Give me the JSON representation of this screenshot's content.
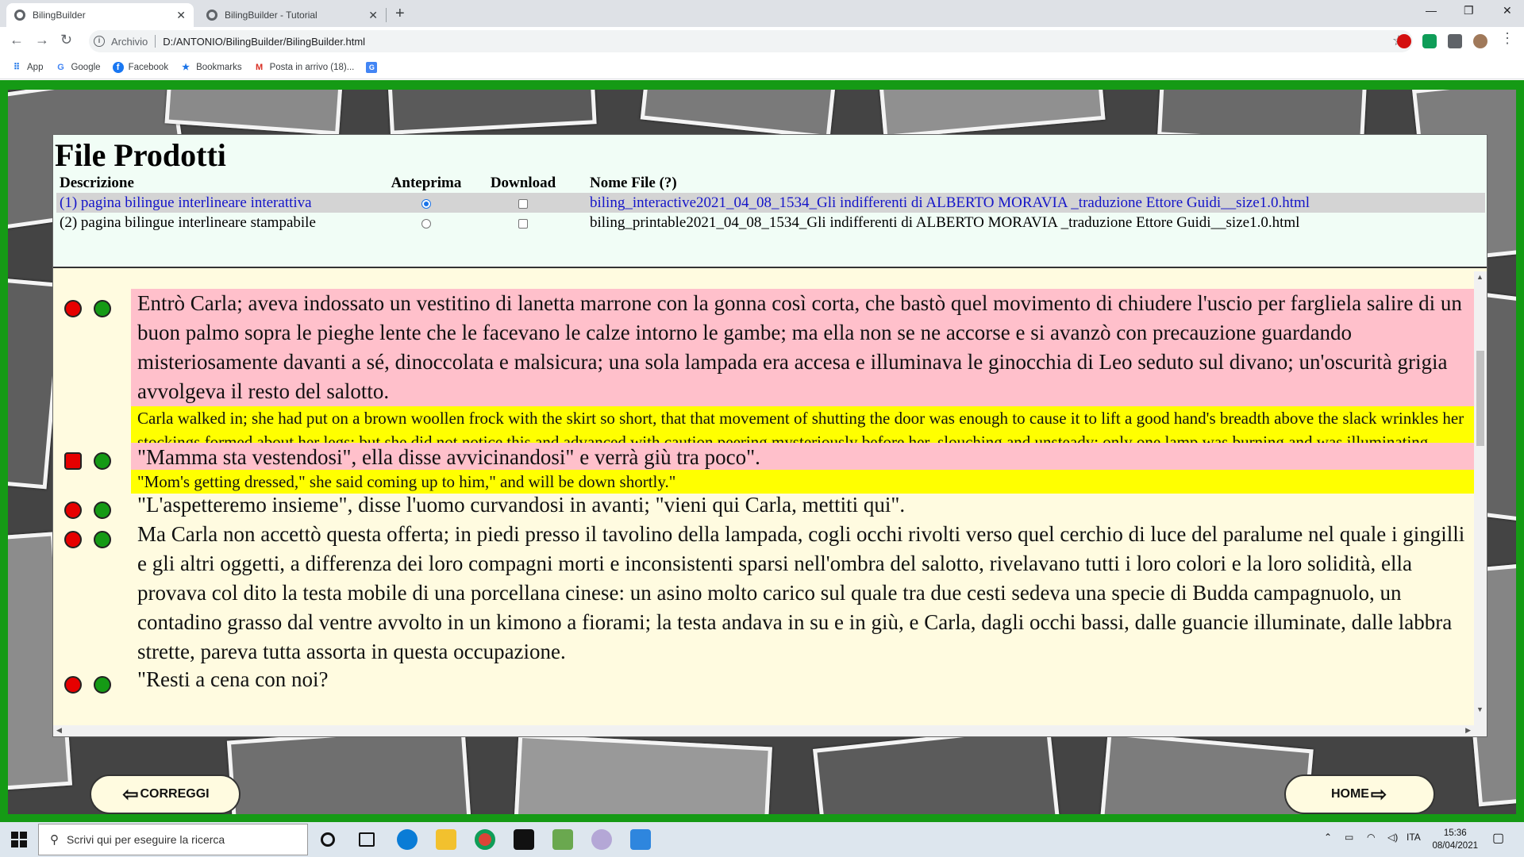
{
  "browser": {
    "tabs": [
      {
        "title": "BilingBuilder",
        "active": true
      },
      {
        "title": "BilingBuilder - Tutorial",
        "active": false
      }
    ],
    "new_tab_icon": "plus-icon",
    "address": {
      "origin": "Archivio",
      "path": "D:/ANTONIO/BilingBuilder/BilingBuilder.html"
    },
    "bookmarks": [
      {
        "label": "App",
        "icon": "apps-grid-icon"
      },
      {
        "label": "Google",
        "icon": "google-icon"
      },
      {
        "label": "Facebook",
        "icon": "facebook-icon"
      },
      {
        "label": "Bookmarks",
        "icon": "star-icon"
      },
      {
        "label": "Posta in arrivo (18)...",
        "icon": "gmail-icon"
      },
      {
        "label": "",
        "icon": "translate-icon"
      }
    ]
  },
  "files_panel": {
    "title": "File Prodotti",
    "headers": {
      "description": "Descrizione",
      "preview": "Anteprima",
      "download": "Download",
      "filename": "Nome File (?)"
    },
    "rows": [
      {
        "description": "(1) pagina bilingue interlineare interattiva",
        "preview_selected": true,
        "download_checked": false,
        "filename": "biling_interactive2021_04_08_1534_Gli indifferenti di ALBERTO MORAVIA _traduzione Ettore Guidi__size1.0.html"
      },
      {
        "description": "(2) pagina bilingue interlineare stampabile",
        "preview_selected": false,
        "download_checked": false,
        "filename": "biling_printable2021_04_08_1534_Gli indifferenti di ALBERTO MORAVIA _traduzione Ettore Guidi__size1.0.html"
      }
    ]
  },
  "text": {
    "p1_it": "Entrò Carla; aveva indossato un vestitino di lanetta marrone con la gonna così corta, che bastò quel movimento di chiudere l'uscio per fargliela salire di un buon palmo sopra le pieghe lente che le facevano le calze intorno le gambe; ma ella non se ne accorse e si avanzò con precauzione guardando misteriosamente davanti a sé, dinoccolata e malsicura; una sola lampada era accesa e illuminava le ginocchia di Leo seduto sul divano; un'oscurità grigia avvolgeva il resto del salotto.",
    "p1_en": "Carla walked in; she had put on a brown woollen frock with the skirt so short, that that movement of shutting the door was enough to cause it to lift a good hand's breadth above the slack wrinkles her stockings formed about her legs; but she did not notice this and advanced with caution peering mysteriously before her, slouching and unsteady; only one lamp was burning and was illuminating Leo's knees as he sat on the sofa; a grey gloom swathed the rest of the living-room.",
    "p2_it": "\"Mamma sta vestendosi\", ella disse avvicinandosi\" e verrà giù tra poco\".",
    "p2_en": "\"Mom's getting dressed,\" she said coming up to him,\" and will be down shortly.\"",
    "p3_it": "\"L'aspetteremo insieme\", disse l'uomo curvandosi in avanti; \"vieni qui Carla, mettiti qui\".",
    "p4_it": "Ma Carla non accettò questa offerta; in piedi presso il tavolino della lampada, cogli occhi rivolti verso quel cerchio di luce del paralume nel quale i gingilli e gli altri oggetti, a differenza dei loro compagni morti e inconsistenti sparsi nell'ombra del salotto, rivelavano tutti i loro colori e la loro solidità, ella provava col dito la testa mobile di una porcellana cinese: un asino molto carico sul quale tra due cesti sedeva una specie di Budda campagnuolo, un contadino grasso dal ventre avvolto in un kimono a fiorami; la testa andava in su e in giù, e Carla, dagli occhi bassi, dalle guancie illuminate, dalle labbra strette, pareva tutta assorta in questa occupazione.",
    "p5_it": "\"Resti a cena con noi?"
  },
  "buttons": {
    "back": "CORREGGI",
    "home": "HOME"
  },
  "taskbar": {
    "search_placeholder": "Scrivi qui per eseguire la ricerca",
    "lang": "ITA",
    "time": "15:36",
    "date": "08/04/2021"
  },
  "colors": {
    "page_border": "#159a15",
    "italian_highlight": "#ffc0cb",
    "english_highlight": "#ffff00",
    "text_bg": "#fffbe0"
  }
}
